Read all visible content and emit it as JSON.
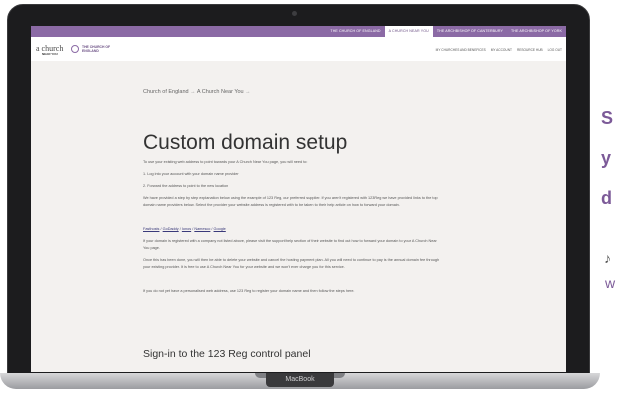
{
  "laptop": {
    "brand": "MacBook"
  },
  "site": {
    "top_tabs": [
      {
        "label": "THE CHURCH OF ENGLAND",
        "active": false
      },
      {
        "label": "A CHURCH NEAR YOU",
        "active": true
      },
      {
        "label": "THE ARCHBISHOP OF CANTERBURY",
        "active": false
      },
      {
        "label": "THE ARCHBISHOP OF YORK",
        "active": false
      }
    ],
    "logo_main": "a church",
    "logo_sub": "NEAR YOU",
    "logo_coe": "THE CHURCH OF ENGLAND",
    "header_links": [
      "MY CHURCHES AND BENEFICES",
      "MY ACCOUNT",
      "RESOURCE HUB",
      "LOG OUT"
    ],
    "breadcrumb": [
      "Church of England",
      "A Church Near You"
    ],
    "title": "Custom domain setup",
    "paragraphs": [
      "To use your existing web address to point towards your A Church Near You page, you will need to:",
      "1. Log into your account with your domain name provider",
      "2. Forward the address to point to the new location",
      "We have provided a step by step explanation below using the example of 123 Reg, our preferred supplier. If you aren't registered with 123Reg we have provided links to the top domain name providers below. Select the provider your website address is registered with to be taken to their help article on how to forward your domain.",
      "If your domain is registered with a company not listed above, please visit the support/help section of their website to find out how to forward your domain to your A Church Near You page.",
      "Once this has been done, you will then be able to delete your website and cancel the hosting payment plan. All you will need to continue to pay is the annual domain fee through your existing provider. It is free to use A Church Near You for your website and we won't ever charge you for this service.",
      "If you do not yet have a personalised web address, use 123 Reg to register your domain name and then follow the steps here."
    ],
    "providers": [
      "Fasthosts",
      "GoDaddy",
      "Ionos",
      "Namesco",
      "Google"
    ],
    "section_heading": "Sign-in to the 123 Reg control panel"
  },
  "promo": {
    "lines": [
      "S",
      "y",
      "d"
    ],
    "icon": "♪",
    "small": "w"
  }
}
